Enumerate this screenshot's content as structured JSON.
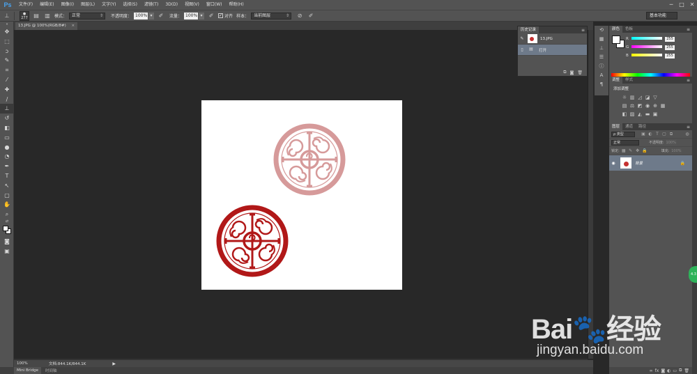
{
  "app": {
    "logo": "Ps"
  },
  "menu": [
    "文件(F)",
    "编辑(E)",
    "图像(I)",
    "图层(L)",
    "文字(Y)",
    "选择(S)",
    "滤镜(T)",
    "3D(D)",
    "视图(V)",
    "窗口(W)",
    "帮助(H)"
  ],
  "window_controls": {
    "minimize": "─",
    "maximize": "□",
    "close": "✕"
  },
  "options": {
    "brush_size": "277",
    "mode_label": "模式：",
    "mode_value": "正常",
    "opacity_label": "不透明度：",
    "opacity_value": "100%",
    "flow_label": "流量：",
    "flow_value": "100%",
    "aligned_label": "对齐",
    "aligned_checked": "✓",
    "sample_label": "样本：",
    "sample_value": "当前图层",
    "workspace": "基本功能"
  },
  "document": {
    "tab_title": "13.JPG @ 100%(RGB/8#)",
    "close": "×"
  },
  "status": {
    "zoom": "100%",
    "doc_size": "文档:844.1K/844.1K",
    "arrow": "▶"
  },
  "bottom_tabs": {
    "mini_bridge": "Mini Bridge",
    "timeline": "时间轴"
  },
  "history": {
    "title": "历史记录",
    "menu": "≡",
    "snapshot": "13.JPG",
    "step": "打开"
  },
  "color_panel": {
    "tabs": [
      "颜色",
      "色板"
    ],
    "r_label": "R",
    "g_label": "G",
    "b_label": "B",
    "r": "255",
    "g": "255",
    "b": "255",
    "fg_color": "#ffffff",
    "bg_color": "#ffffff"
  },
  "adjustments": {
    "tabs": [
      "调整",
      "样式"
    ],
    "title": "添加调整"
  },
  "layers": {
    "tabs": [
      "图层",
      "通道",
      "路径"
    ],
    "kind": "ρ 类型",
    "blend": "正常",
    "opacity_label": "不透明度:",
    "opacity_value": "100%",
    "lock_label": "锁定:",
    "fill_label": "填充:",
    "fill_value": "100%",
    "layer_name": "背景"
  },
  "helper_badge": "4.3",
  "watermark": {
    "brand": "Bai🐾经验",
    "site": "jingyan.baidu.com"
  },
  "stamp_colors": {
    "faded": "#d69a9a",
    "solid": "#b11818"
  }
}
